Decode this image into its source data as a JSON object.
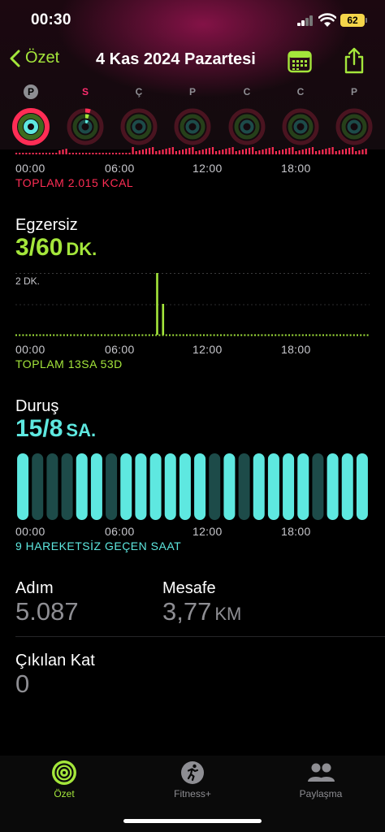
{
  "status": {
    "time": "00:30",
    "battery": "62"
  },
  "nav": {
    "back_label": "Özet",
    "title": "4 Kas 2024 Pazartesi"
  },
  "week": [
    {
      "letter": "P",
      "today": true
    },
    {
      "letter": "S",
      "sunday": true
    },
    {
      "letter": "Ç"
    },
    {
      "letter": "P"
    },
    {
      "letter": "C"
    },
    {
      "letter": "C"
    },
    {
      "letter": "P"
    }
  ],
  "colors": {
    "move": "#ff2d55",
    "exercise": "#a4e63b",
    "stand": "#5ee8e0",
    "stand_dim": "#1d4b49",
    "accent": "#a4e63b"
  },
  "axis_ticks": [
    "00:00",
    "06:00",
    "12:00",
    "18:00"
  ],
  "move": {
    "total": "TOPLAM 2.015 KCAL"
  },
  "exercise": {
    "title": "Egzersiz",
    "value": "3/60",
    "unit": "DK.",
    "scale_label": "2 DK.",
    "total": "TOPLAM 13SA 53D",
    "chart_data": {
      "type": "bar",
      "x_unit": "hour",
      "bars": [
        {
          "hour": 9.6,
          "minutes": 2
        },
        {
          "hour": 10.0,
          "minutes": 1
        }
      ],
      "ylim": [
        0,
        2
      ]
    }
  },
  "stand": {
    "title": "Duruş",
    "value": "15/8",
    "unit": "SA.",
    "inactive_label": "9 HAREKETSİZ GEÇEN SAAT",
    "hours": [
      1,
      0,
      0,
      0,
      1,
      1,
      0,
      1,
      1,
      1,
      1,
      1,
      1,
      0,
      1,
      0,
      1,
      1,
      1,
      1,
      0,
      1,
      1,
      1
    ]
  },
  "stats": {
    "steps_label": "Adım",
    "steps_value": "5.087",
    "distance_label": "Mesafe",
    "distance_value": "3,77",
    "distance_unit": "KM",
    "floors_label": "Çıkılan Kat",
    "floors_value": "0"
  },
  "tabs": [
    {
      "label": "Özet",
      "active": true
    },
    {
      "label": "Fitness+"
    },
    {
      "label": "Paylaşma"
    }
  ]
}
